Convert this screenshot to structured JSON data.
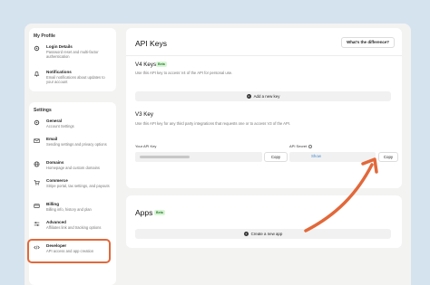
{
  "colors": {
    "accent": "#e2683a",
    "background": "#d5e3ee",
    "beta_bg": "#d8f5d6",
    "link": "#4a8cd0"
  },
  "sidebar": {
    "profile_title": "My Profile",
    "profile_items": [
      {
        "label": "Login Details",
        "desc": "Password reset and multi-factor authentication",
        "icon": "gear-icon"
      },
      {
        "label": "Notifications",
        "desc": "Email notifications about updates to your account",
        "icon": "bell-icon"
      }
    ],
    "settings_title": "Settings",
    "settings_items": [
      {
        "label": "General",
        "desc": "Account Settings",
        "icon": "gear-icon"
      },
      {
        "label": "Email",
        "desc": "Sending settings and privacy options",
        "icon": "mail-icon"
      },
      {
        "label": "Domains",
        "desc": "Homepage and custom domains",
        "icon": "globe-icon"
      },
      {
        "label": "Commerce",
        "desc": "Stripe portal, tax settings, and payouts",
        "icon": "cart-icon"
      },
      {
        "label": "Billing",
        "desc": "Billing info, history and plan",
        "icon": "card-icon"
      },
      {
        "label": "Advanced",
        "desc": "Affiliates link and tracking options",
        "icon": "sliders-icon"
      },
      {
        "label": "Developer",
        "desc": "API access and app creation",
        "icon": "code-icon"
      }
    ]
  },
  "api_keys": {
    "title": "API Keys",
    "difference_button": "What's the difference?",
    "v4": {
      "title": "V4 Keys",
      "badge": "Beta",
      "desc": "Use this API key to access V4 of the API for personal use.",
      "add_button": "Add a new key"
    },
    "v3": {
      "title": "V3 Key",
      "desc": "Use this API key for any third party integrations that requests one or to access V3 of the API.",
      "your_key_label": "Your API Key",
      "copy_key_button": "Copy",
      "secret_label": "API Secret",
      "show_link": "Show",
      "copy_secret_button": "Copy"
    }
  },
  "apps": {
    "title": "Apps",
    "badge": "Beta",
    "create_button": "Create a new app"
  }
}
